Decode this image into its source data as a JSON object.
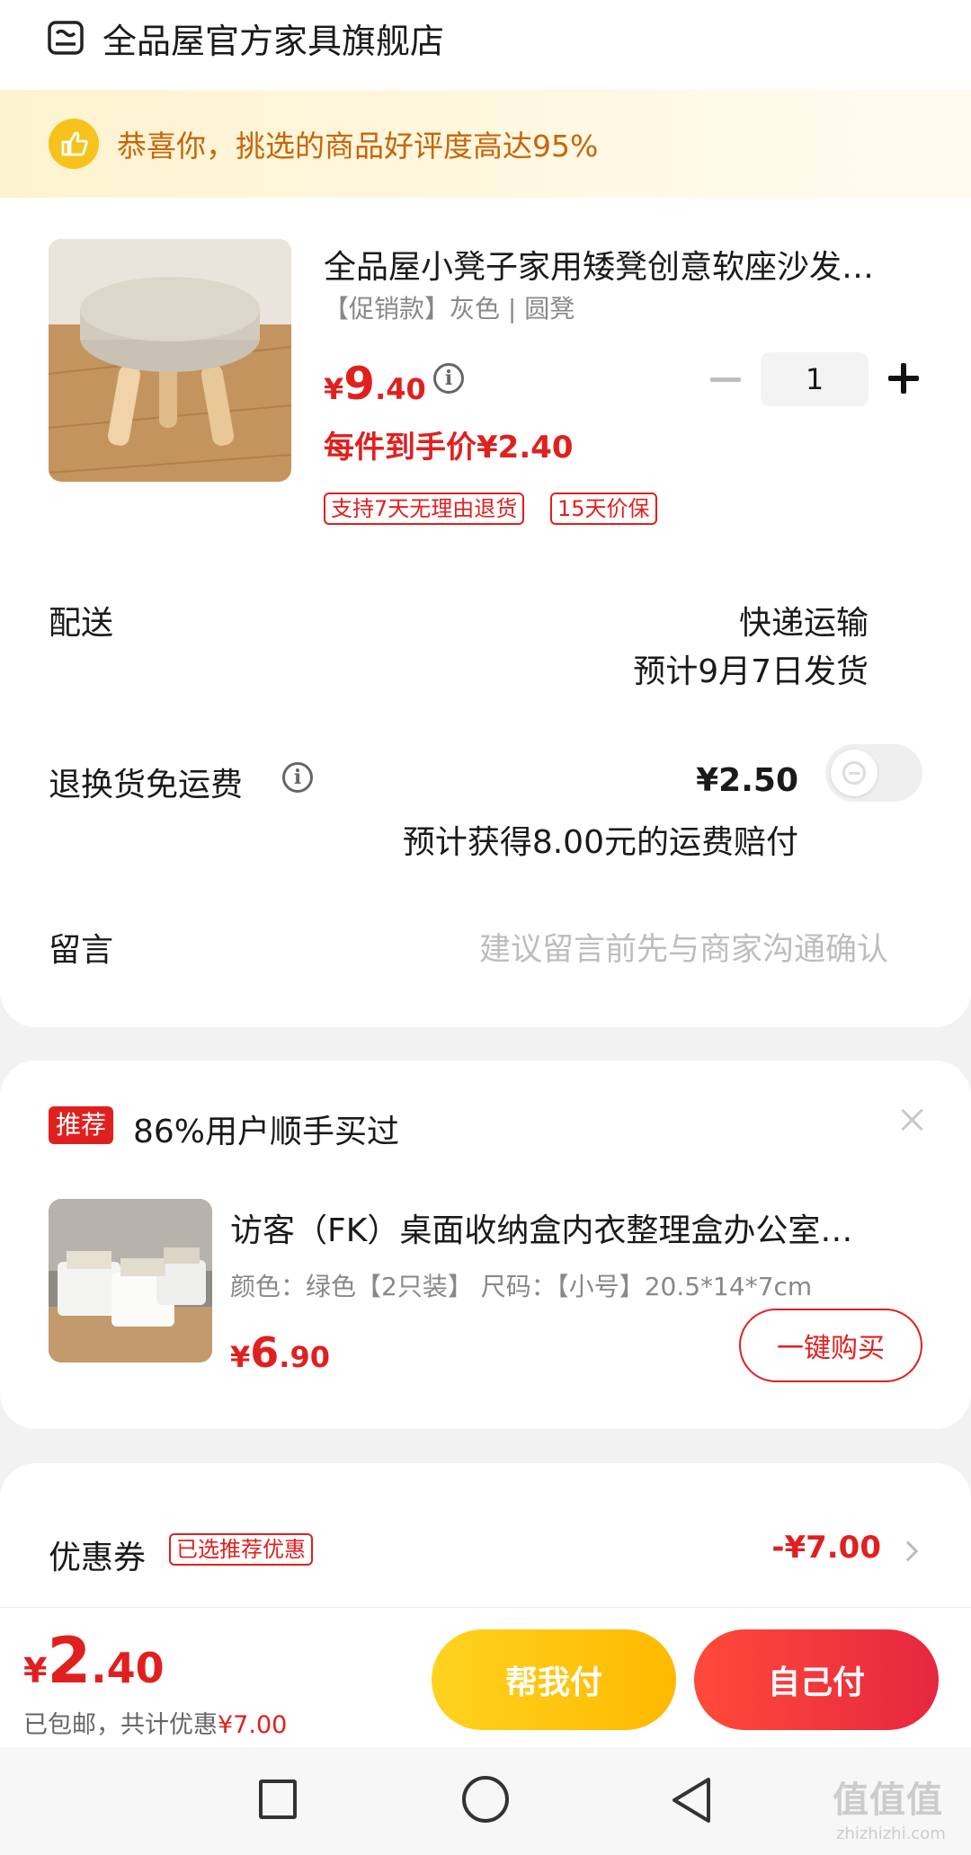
{
  "store": {
    "name": "全品屋官方家具旗舰店",
    "icon": "store-icon"
  },
  "banner": {
    "text": "恭喜你，挑选的商品好评度高达95%",
    "icon": "thumbs-up-icon"
  },
  "product": {
    "title": "全品屋小凳子家用矮凳创意软座沙发…",
    "spec": "【促销款】灰色 | 圆凳",
    "price": {
      "symbol": "¥",
      "integer": "9",
      "decimal": ".40"
    },
    "unit_price": "每件到手价¥2.40",
    "tags": [
      "支持7天无理由退货",
      "15天价保"
    ],
    "quantity": "1"
  },
  "delivery": {
    "label": "配送",
    "method": "快递运输",
    "estimate": "预计9月7日发货"
  },
  "return_shipping": {
    "label": "退换货免运费",
    "price": "¥2.50",
    "note": "预计获得8.00元的运费赔付",
    "enabled": false
  },
  "message": {
    "label": "留言",
    "placeholder": "建议留言前先与商家沟通确认"
  },
  "recommend": {
    "badge": "推荐",
    "title": "86%用户顺手买过",
    "item": {
      "name": "访客（FK）桌面收纳盒内衣整理盒办公室…",
      "spec": "颜色：绿色【2只装】   尺码：【小号】20.5*14*7cm",
      "price": {
        "symbol": "¥",
        "integer": "6",
        "decimal": ".90"
      },
      "buy_label": "一键购买"
    }
  },
  "coupon": {
    "label": "优惠券",
    "tag": "已选推荐优惠",
    "value": "-¥7.00"
  },
  "pay_bar": {
    "total": {
      "symbol": "¥",
      "integer": "2",
      "decimal": ".40"
    },
    "shipping_note": "已包邮，共计优惠",
    "discount": "¥7.00",
    "help_pay_label": "帮我付",
    "self_pay_label": "自己付"
  },
  "watermark": {
    "main": "值值值",
    "sub": "zhizhizhi.com"
  },
  "colors": {
    "accent_red": "#e0201f",
    "banner_orange": "#c8650a",
    "help_yellow": "#ffc107"
  }
}
